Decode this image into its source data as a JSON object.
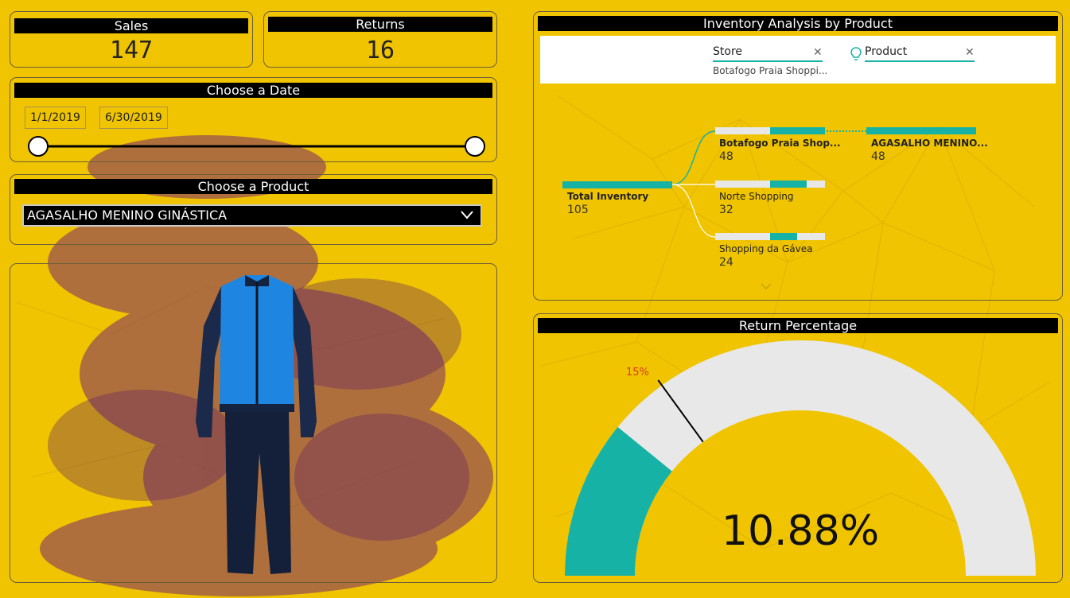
{
  "kpis": {
    "sales": {
      "label": "Sales",
      "value": "147"
    },
    "returns": {
      "label": "Returns",
      "value": "16"
    }
  },
  "date_slicer": {
    "title": "Choose a Date",
    "start": "1/1/2019",
    "end": "6/30/2019"
  },
  "product_slicer": {
    "title": "Choose a Product",
    "selected": "AGASALHO MENINO GINÁSTICA"
  },
  "inventory": {
    "title": "Inventory Analysis by Product",
    "filters": [
      {
        "name": "Store",
        "value": "Botafogo Praia Shoppi..."
      },
      {
        "name": "Product"
      }
    ],
    "root": {
      "label": "Total Inventory",
      "value": "105"
    },
    "stores": [
      {
        "label": "Botafogo Praia Shop...",
        "value": "48",
        "fraction": 0.46
      },
      {
        "label": "Norte Shopping",
        "value": "32",
        "fraction": 0.3
      },
      {
        "label": "Shopping da Gávea",
        "value": "24",
        "fraction": 0.23
      }
    ],
    "product": {
      "label": "AGASALHO MENINO...",
      "value": "48",
      "fraction": 1.0
    }
  },
  "gauge": {
    "title": "Return Percentage",
    "value": 10.88,
    "value_text": "10.88%",
    "target": 15,
    "target_text": "15%",
    "max": 50
  },
  "colors": {
    "background": "#f0c400",
    "teal": "#17b2a6",
    "header": "#000000",
    "track": "#e8e8e8",
    "target": "#d93a1a"
  }
}
